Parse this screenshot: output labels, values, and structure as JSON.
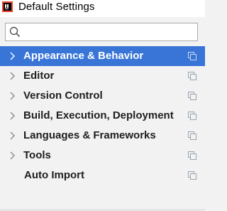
{
  "window": {
    "title": "Default Settings"
  },
  "search": {
    "value": "",
    "placeholder": ""
  },
  "tree": {
    "items": [
      {
        "label": "Appearance & Behavior",
        "selected": true,
        "expandable": true
      },
      {
        "label": "Editor",
        "selected": false,
        "expandable": true
      },
      {
        "label": "Version Control",
        "selected": false,
        "expandable": true
      },
      {
        "label": "Build, Execution, Deployment",
        "selected": false,
        "expandable": true
      },
      {
        "label": "Languages & Frameworks",
        "selected": false,
        "expandable": true
      },
      {
        "label": "Tools",
        "selected": false,
        "expandable": true
      },
      {
        "label": "Auto Import",
        "selected": false,
        "expandable": false
      }
    ]
  },
  "icons": {
    "app": "intellij-app-icon",
    "search": "search-icon",
    "expand": "chevron-right-icon",
    "copy": "copy-settings-icon"
  },
  "colors": {
    "selection": "#3875d7",
    "background": "#f2f2f2"
  }
}
